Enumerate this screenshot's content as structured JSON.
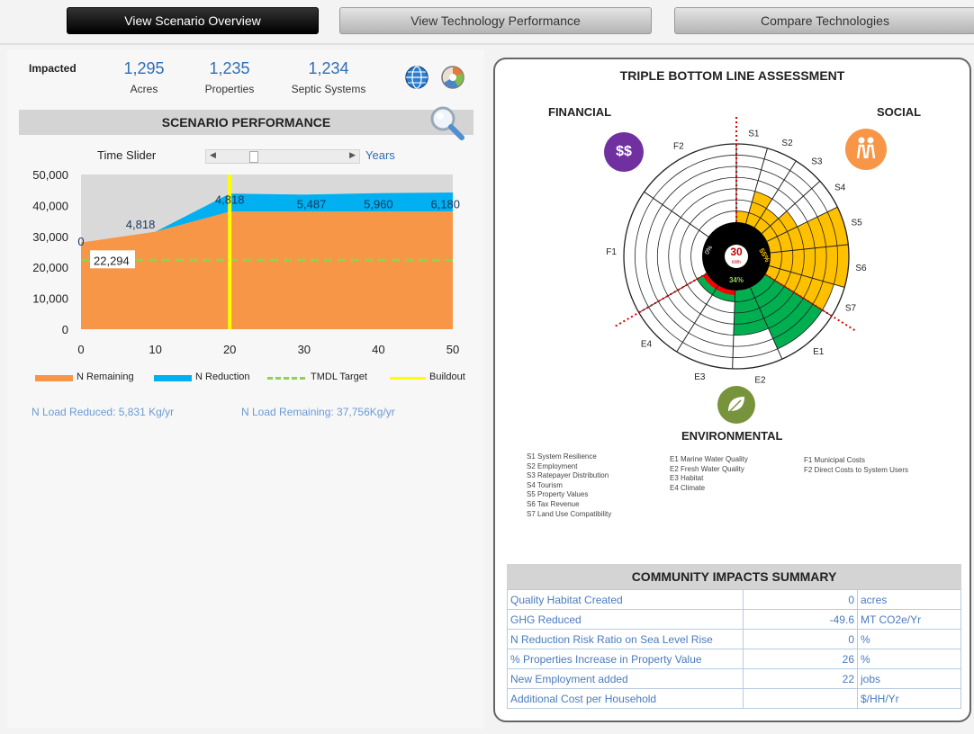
{
  "nav": {
    "overview": "View Scenario Overview",
    "performance": "View Technology  Performance",
    "compare": "Compare Technologies"
  },
  "impacted": {
    "label": "Impacted",
    "items": [
      {
        "value": "1,295",
        "label": "Acres"
      },
      {
        "value": "1,235",
        "label": "Properties"
      },
      {
        "value": "1,234",
        "label": "Septic Systems"
      }
    ]
  },
  "scenario": {
    "title": "SCENARIO PERFORMANCE",
    "time_slider_label": "Time Slider",
    "years_label": "Years",
    "n_load_reduced": "N Load Reduced: 5,831 Kg/yr",
    "n_load_remaining": "N Load Remaining: 37,756Kg/yr"
  },
  "colors": {
    "remaining": "#f79646",
    "reduction": "#00b0f0",
    "tmdl": "#92d050",
    "buildout": "#ffff00",
    "social": "#ffc000",
    "environmental": "#00b050",
    "financial": "#ff0000",
    "blue_text": "#2f6eb5"
  },
  "chart_data": {
    "type": "area",
    "title": "",
    "xlabel": "",
    "ylabel": "",
    "x": [
      0,
      10,
      20,
      30,
      40,
      50
    ],
    "xlim": [
      0,
      50
    ],
    "ylim": [
      0,
      50000
    ],
    "x_ticks": [
      "0",
      "10",
      "20",
      "30",
      "40",
      "50"
    ],
    "y_ticks": [
      "0",
      "10,000",
      "20,000",
      "30,000",
      "40,000",
      "50,000"
    ],
    "series": [
      {
        "name": "N Remaining",
        "values": [
          28000,
          31500,
          38000,
          38000,
          38000,
          38000
        ]
      },
      {
        "name": "N Reduction",
        "values": [
          0,
          0,
          5818,
          5487,
          5960,
          6180
        ]
      }
    ],
    "tmdl_target": 22294,
    "tmdl_label": "22,294",
    "buildout_year": 20,
    "data_labels": [
      {
        "x": 0,
        "y": 28500,
        "text": "0"
      },
      {
        "x": 8,
        "y": 34000,
        "text": "4,818"
      },
      {
        "x": 20,
        "y": 42000,
        "text": "4,818"
      },
      {
        "x": 31,
        "y": 40500,
        "text": "5,487"
      },
      {
        "x": 40,
        "y": 40500,
        "text": "5,960"
      },
      {
        "x": 49,
        "y": 40500,
        "text": "6,180"
      }
    ],
    "legend": [
      "N Remaining",
      "N Reduction",
      "TMDL Target",
      "Buildout"
    ],
    "legend_position": "bottom"
  },
  "tbl": {
    "title": "TRIPLE BOTTOM LINE ASSESSMENT",
    "financial": "FINANCIAL",
    "social": "SOCIAL",
    "environmental": "ENVIRONMENTAL",
    "financial_icon_text": "$$",
    "center_value": "30",
    "center_unit": "kWh",
    "env_pct": "34%",
    "social_pct": "55%",
    "fin_pct": "0%",
    "radar_data": {
      "type": "radar",
      "rings": 7,
      "segments": [
        {
          "label": "S1",
          "value": 1,
          "group": "social"
        },
        {
          "label": "S2",
          "value": 3,
          "group": "social"
        },
        {
          "label": "S3",
          "value": 2,
          "group": "social"
        },
        {
          "label": "S4",
          "value": 3,
          "group": "social"
        },
        {
          "label": "S5",
          "value": 7,
          "group": "social"
        },
        {
          "label": "S6",
          "value": 7,
          "group": "social"
        },
        {
          "label": "S7",
          "value": 6,
          "group": "social"
        },
        {
          "label": "E1",
          "value": 6,
          "group": "environmental"
        },
        {
          "label": "E2",
          "value": 4,
          "group": "environmental"
        },
        {
          "label": "E3",
          "value": 1,
          "group": "environmental"
        },
        {
          "label": "E4",
          "value": 1,
          "group": "environmental"
        },
        {
          "label": "F1",
          "value": 0,
          "group": "financial"
        },
        {
          "label": "F2",
          "value": 0,
          "group": "financial"
        }
      ]
    },
    "definitions_s": [
      "S1   System Resilience",
      "S2   Employment",
      "S3   Ratepayer Distribution",
      "S4   Tourism",
      "S5   Property Values",
      "S6   Tax Revenue",
      "S7   Land Use Compatibility"
    ],
    "definitions_e": [
      "E1   Marine Water Quality",
      "E2   Fresh Water Quality",
      "E3   Habitat",
      "E4   Climate"
    ],
    "definitions_f": [
      "F1   Municipal Costs",
      "F2   Direct Costs to System Users"
    ]
  },
  "cis": {
    "title": "COMMUNITY IMPACTS SUMMARY",
    "rows": [
      {
        "label": "Quality Habitat Created",
        "value": "0",
        "unit": "acres"
      },
      {
        "label": "GHG Reduced",
        "value": "-49.6",
        "unit": "MT CO2e/Yr"
      },
      {
        "label": "N Reduction Risk Ratio on Sea Level Rise",
        "value": "0",
        "unit": "%"
      },
      {
        "label": "% Properties Increase in Property Value",
        "value": "26",
        "unit": "%"
      },
      {
        "label": "New Employment added",
        "value": "22",
        "unit": "jobs"
      },
      {
        "label": "Additional Cost per Household",
        "value": "",
        "unit": "$/HH/Yr"
      }
    ]
  }
}
